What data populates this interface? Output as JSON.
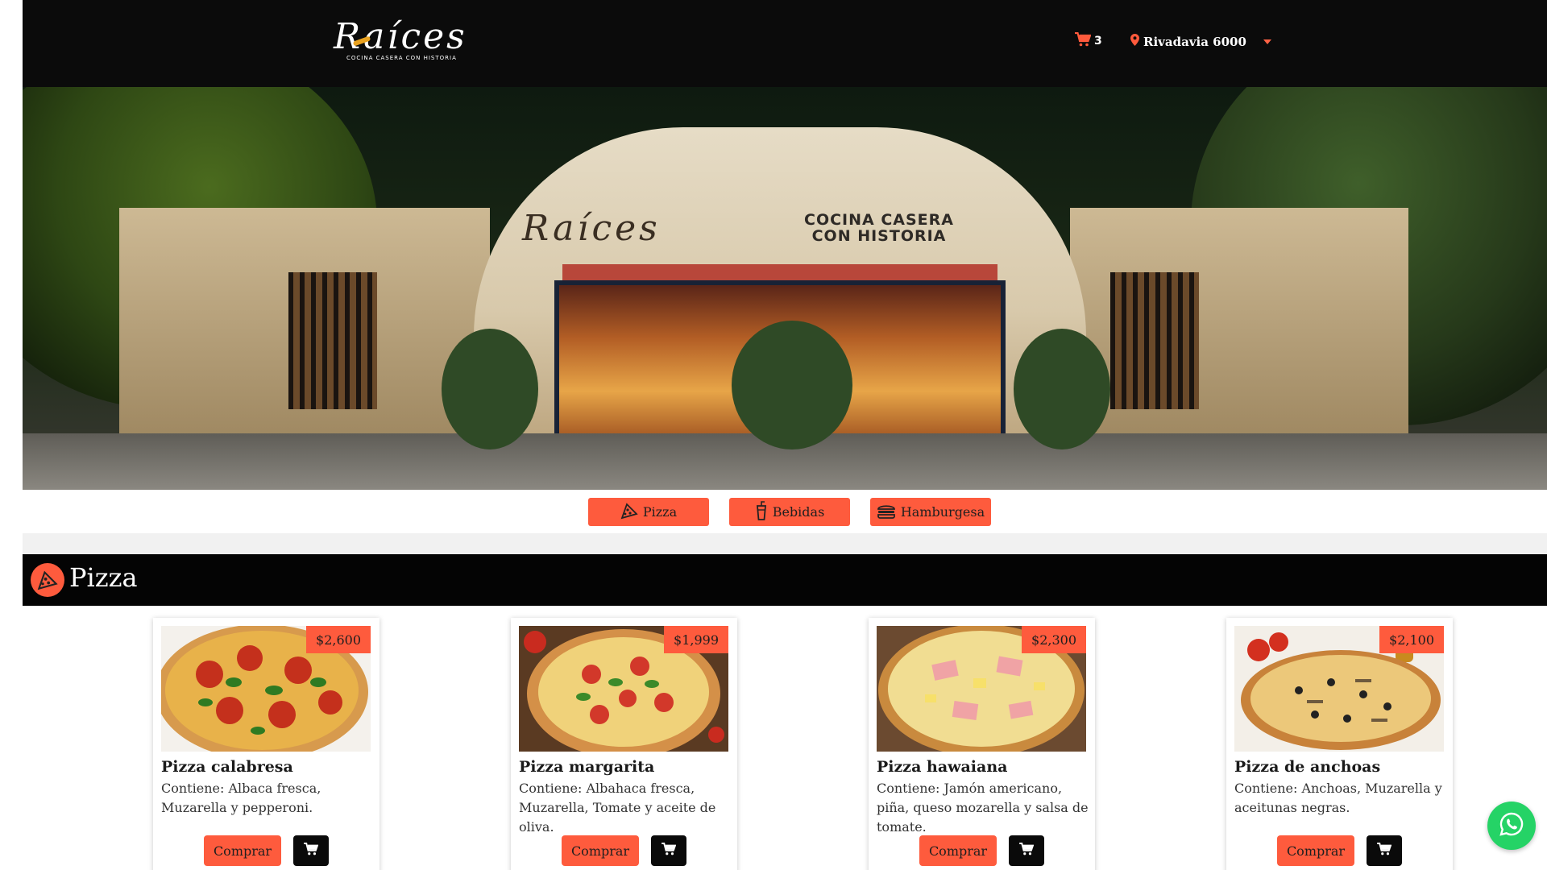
{
  "header": {
    "logo_text": "Raíces",
    "logo_tagline": "COCINA CASERA CON HISTORIA",
    "cart_count": "3",
    "location": "Rivadavia 6000"
  },
  "hero": {
    "sign_name": "Raíces",
    "sign_tagline_line1": "COCINA CASERA",
    "sign_tagline_line2": "CON HISTORIA"
  },
  "categories": [
    {
      "label": "Pizza",
      "icon": "pizza-icon"
    },
    {
      "label": "Bebidas",
      "icon": "drink-icon"
    },
    {
      "label": "Hamburgesa",
      "icon": "burger-icon"
    }
  ],
  "section": {
    "title": "Pizza",
    "icon": "pizza-icon"
  },
  "products": [
    {
      "name": "Pizza calabresa",
      "price": "$2,600",
      "description": "Contiene: Albaca fresca, Muzarella y pepperoni.",
      "buy_label": "Comprar"
    },
    {
      "name": "Pizza margarita",
      "price": "$1,999",
      "description": "Contiene: Albahaca fresca, Muzarella, Tomate y aceite de oliva.",
      "buy_label": "Comprar"
    },
    {
      "name": "Pizza hawaiana",
      "price": "$2,300",
      "description": "Contiene: Jamón americano, piña, queso mozarella y salsa de tomate.",
      "buy_label": "Comprar"
    },
    {
      "name": "Pizza de anchoas",
      "price": "$2,100",
      "description": "Contiene: Anchoas, Muzarella y aceitunas negras.",
      "buy_label": "Comprar"
    }
  ],
  "colors": {
    "accent": "#fe5b3d",
    "header_bg": "#0b0b0b",
    "whatsapp": "#25d366"
  }
}
